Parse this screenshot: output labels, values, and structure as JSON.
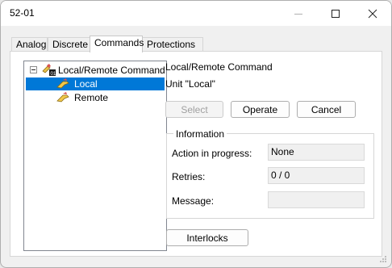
{
  "window": {
    "title": "52-01"
  },
  "tabs": [
    {
      "label": "Analog"
    },
    {
      "label": "Discrete"
    },
    {
      "label": "Commands"
    },
    {
      "label": "Protections"
    }
  ],
  "tree": {
    "root": {
      "label": "Local/Remote Command",
      "icon": "switch-command-icon"
    },
    "children": [
      {
        "label": "Local",
        "icon": "hand-command-icon",
        "selected": true
      },
      {
        "label": "Remote",
        "icon": "hand-command-icon",
        "selected": false
      }
    ]
  },
  "command": {
    "title": "Local/Remote Command",
    "unit": "Unit \"Local\""
  },
  "buttons": {
    "select": "Select",
    "operate": "Operate",
    "cancel": "Cancel",
    "interlocks": "Interlocks"
  },
  "information": {
    "title": "Information",
    "action_label": "Action in progress:",
    "action_value": "None",
    "retries_label": "Retries:",
    "retries_value": "0 / 0",
    "message_label": "Message:",
    "message_value": ""
  },
  "colors": {
    "selection": "#0078d7",
    "window_bg": "#f0f0f0",
    "panel_bg": "#ffffff"
  }
}
